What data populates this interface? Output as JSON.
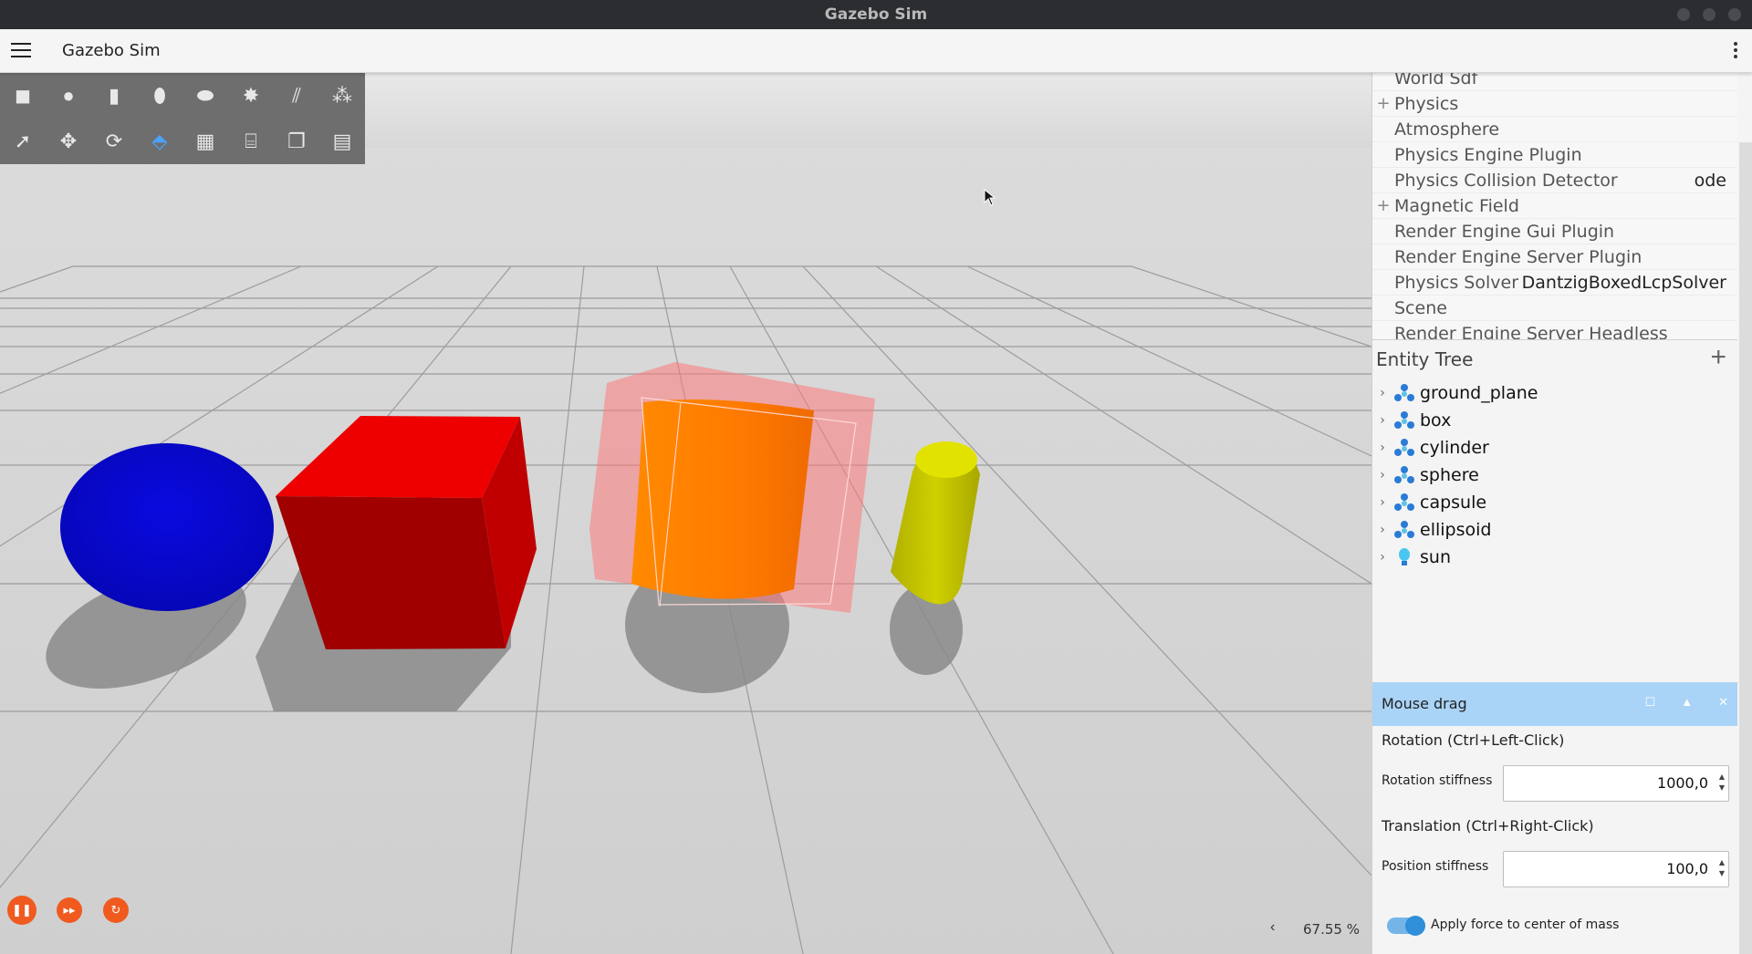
{
  "window": {
    "os_title": "Gazebo Sim"
  },
  "app_bar": {
    "title": "Gazebo Sim",
    "menu_icon": "hamburger-menu-icon",
    "more_icon": "vertical-dots-icon"
  },
  "toolbar": {
    "row1": [
      "box-shape-icon",
      "sphere-shape-icon",
      "cylinder-shape-icon",
      "capsule-shape-icon",
      "ellipsoid-shape-icon",
      "point-light-icon",
      "directional-light-icon",
      "spot-light-icon"
    ],
    "row2": [
      "select-icon",
      "translate-icon",
      "rotate-icon",
      "view-angle-icon",
      "grid-snap-icon",
      "screenshot-camera-icon",
      "copy-icon",
      "paste-icon"
    ]
  },
  "scene": {
    "objects": [
      {
        "name": "sphere",
        "color": "#0a0ad0"
      },
      {
        "name": "box",
        "color": "#e00000"
      },
      {
        "name": "cylinder",
        "color": "#ff7a00"
      },
      {
        "name": "capsule",
        "color": "#c8c800"
      }
    ],
    "highlight_color": "#ff7777"
  },
  "bottom": {
    "zoom_left": "‹",
    "zoom_value": "67.55 %"
  },
  "properties": {
    "rows": [
      {
        "plus": "",
        "name": "World Sdf",
        "value": ""
      },
      {
        "plus": "+",
        "name": "Physics",
        "value": ""
      },
      {
        "plus": "",
        "name": "Atmosphere",
        "value": ""
      },
      {
        "plus": "",
        "name": "Physics Engine Plugin",
        "value": ""
      },
      {
        "plus": "",
        "name": "Physics Collision Detector",
        "value": "ode"
      },
      {
        "plus": "+",
        "name": "Magnetic Field",
        "value": ""
      },
      {
        "plus": "",
        "name": "Render Engine Gui Plugin",
        "value": ""
      },
      {
        "plus": "",
        "name": "Render Engine Server Plugin",
        "value": ""
      },
      {
        "plus": "",
        "name": "Physics Solver",
        "value": "DantzigBoxedLcpSolver"
      },
      {
        "plus": "",
        "name": "Scene",
        "value": ""
      },
      {
        "plus": "",
        "name": "Render Engine Server Headless",
        "value": ""
      }
    ]
  },
  "entity_tree": {
    "title": "Entity Tree",
    "add": "+",
    "items": [
      {
        "label": "ground_plane",
        "icon": "model-icon"
      },
      {
        "label": "box",
        "icon": "model-icon"
      },
      {
        "label": "cylinder",
        "icon": "model-icon"
      },
      {
        "label": "sphere",
        "icon": "model-icon"
      },
      {
        "label": "capsule",
        "icon": "model-icon"
      },
      {
        "label": "ellipsoid",
        "icon": "model-icon"
      },
      {
        "label": "sun",
        "icon": "light-bulb-icon"
      }
    ]
  },
  "mouse_drag": {
    "title": "Mouse drag",
    "rotation_section": "Rotation (Ctrl+Left-Click)",
    "rotation_label": "Rotation stiffness",
    "rotation_value": "1000,0",
    "translation_section": "Translation (Ctrl+Right-Click)",
    "position_label": "Position stiffness",
    "position_value": "100,0",
    "apply_force_label": "Apply force to center of mass",
    "apply_force": true
  }
}
